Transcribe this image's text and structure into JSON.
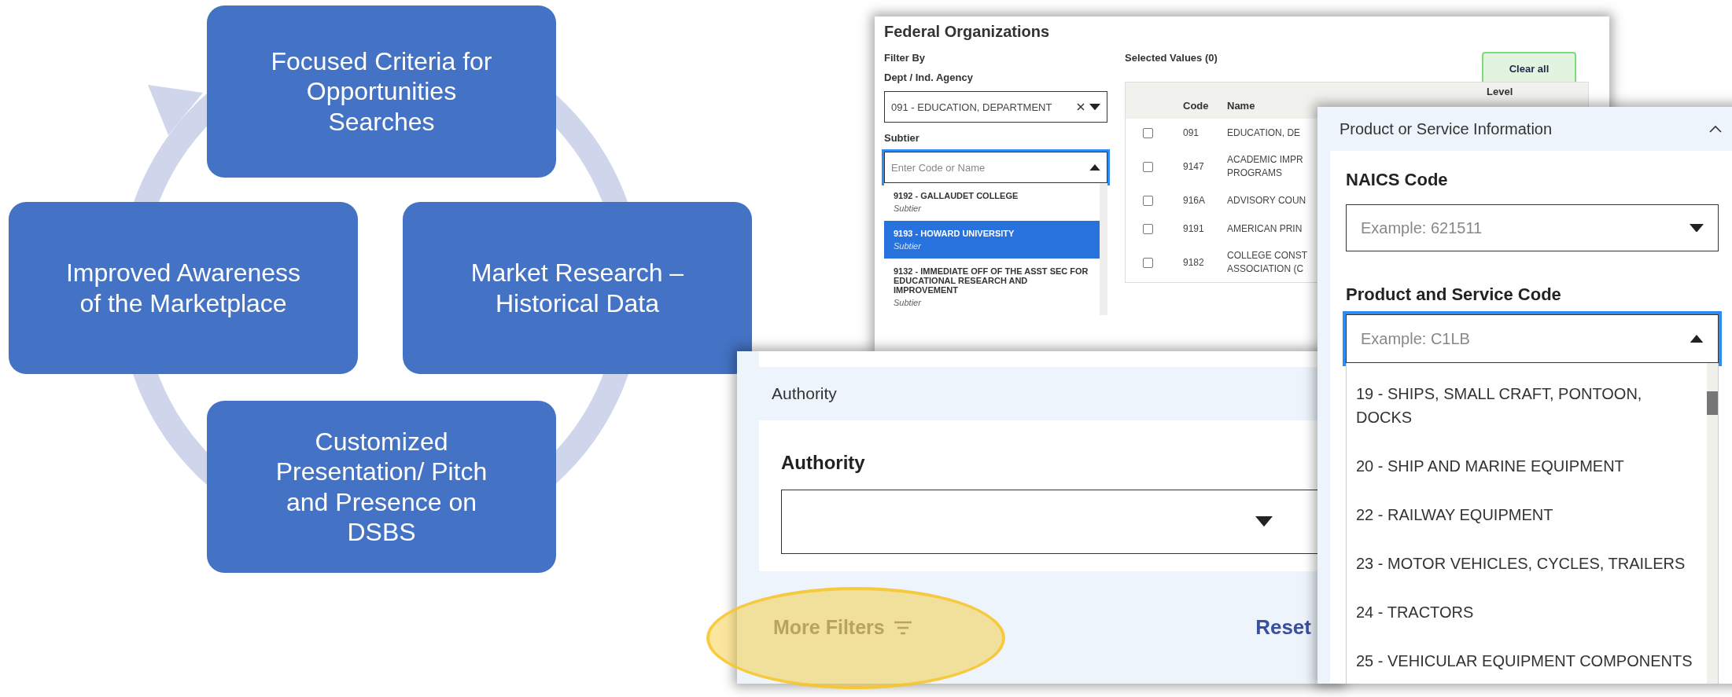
{
  "cycle_diagram": {
    "steps": [
      {
        "text": "Focused Criteria for Opportunities Searches"
      },
      {
        "text": "Improved Awareness of the Marketplace"
      },
      {
        "text": "Market Research – Historical Data"
      },
      {
        "text": "Customized Presentation/ Pitch and Presence on DSBS"
      }
    ]
  },
  "federal_organizations": {
    "title": "Federal Organizations",
    "filter_by": "Filter By",
    "dept_label": "Dept / Ind. Agency",
    "dept_value": "091 - EDUCATION, DEPARTMENT",
    "subtier_label": "Subtier",
    "subtier_placeholder": "Enter Code or Name",
    "subtier_options": [
      {
        "label": "9192 - GALLAUDET COLLEGE",
        "sublabel": "Subtier",
        "selected": false
      },
      {
        "label": "9193 - HOWARD UNIVERSITY",
        "sublabel": "Subtier",
        "selected": true
      },
      {
        "label": "9132 - IMMEDIATE OFF OF THE ASST SEC FOR EDUCATIONAL RESEARCH AND IMPROVEMENT",
        "sublabel": "Subtier",
        "selected": false
      }
    ],
    "selected_values": "Selected Values (0)",
    "clear_button": "Clear all",
    "columns": [
      "Code",
      "Name",
      "Level"
    ],
    "rows": [
      {
        "code": "091",
        "name_lines": [
          "EDUCATION, DE"
        ],
        "checked": false
      },
      {
        "code": "9147",
        "name_lines": [
          "ACADEMIC IMPR",
          "PROGRAMS"
        ],
        "checked": false
      },
      {
        "code": "916A",
        "name_lines": [
          "ADVISORY COUN"
        ],
        "checked": false
      },
      {
        "code": "9191",
        "name_lines": [
          "AMERICAN PRIN"
        ],
        "checked": false
      },
      {
        "code": "9182",
        "name_lines": [
          "COLLEGE CONST",
          "ASSOCIATION (C"
        ],
        "checked": false
      }
    ]
  },
  "authority_panel": {
    "section_title": "Authority",
    "field_label": "Authority",
    "more_filters": "More Filters",
    "reset": "Reset"
  },
  "product_service_panel": {
    "section_title": "Product or Service Information",
    "naics_label": "NAICS Code",
    "naics_placeholder": "Example: 621511",
    "psc_label": "Product and Service Code",
    "psc_placeholder": "Example: C1LB",
    "psc_options": [
      "19 - SHIPS, SMALL CRAFT, PONTOON, DOCKS",
      "20 - SHIP AND MARINE EQUIPMENT",
      "22 - RAILWAY EQUIPMENT",
      "23 - MOTOR VEHICLES, CYCLES, TRAILERS",
      "24 - TRACTORS",
      "25 - VEHICULAR EQUIPMENT COMPONENTS"
    ]
  }
}
